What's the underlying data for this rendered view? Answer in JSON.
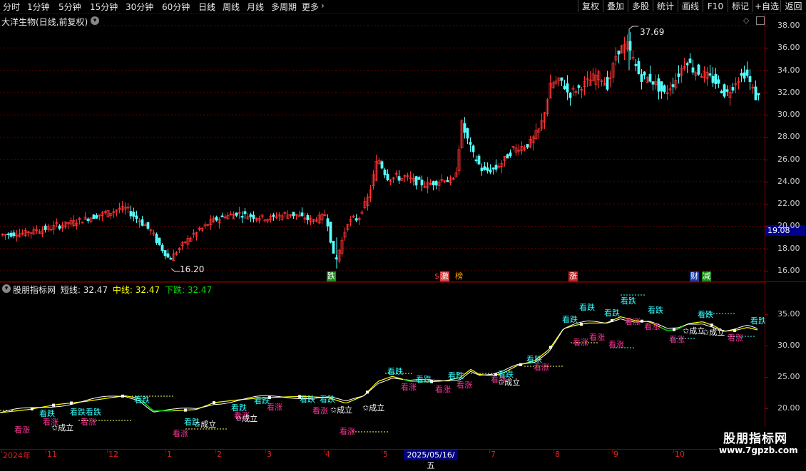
{
  "toolbar": {
    "periods": [
      "分时",
      "1分钟",
      "5分钟",
      "15分钟",
      "30分钟",
      "60分钟",
      "日线",
      "周线",
      "月线",
      "多周期",
      "更多"
    ],
    "active_period": "日线",
    "right_buttons": [
      "复权",
      "叠加",
      "多股",
      "统计",
      "画线",
      "F10",
      "标记",
      "+自选",
      "返回"
    ]
  },
  "main_chart": {
    "title": "大洋生物(日线,前复权)",
    "y_labels": [
      "38.00",
      "36.00",
      "34.00",
      "32.00",
      "30.00",
      "28.00",
      "26.00",
      "24.00",
      "22.00",
      "20.00",
      "18.00",
      "16.00"
    ],
    "high_label": "37.69",
    "low_label": "16.20",
    "current_price": "19.08",
    "event_tags": [
      {
        "text": "跌",
        "bg": "#1a8f1a",
        "fg": "#ffffff"
      },
      {
        "text": "$",
        "bg": "#000000",
        "fg": "#ff3030"
      },
      {
        "text": "激",
        "bg": "#d04040",
        "fg": "#ffffff"
      },
      {
        "text": "榜",
        "bg": "#000000",
        "fg": "#ffa500"
      },
      {
        "text": "涨",
        "bg": "#c02020",
        "fg": "#ffffff"
      },
      {
        "text": "财",
        "bg": "#1e3aa0",
        "fg": "#ffffff"
      },
      {
        "text": "减",
        "bg": "#1a8f1a",
        "fg": "#ffffff"
      }
    ]
  },
  "indicator": {
    "name": "股朋指标网",
    "short_label": "短线:",
    "short_value": "32.47",
    "mid_label": "中线:",
    "mid_value": "32.47",
    "down_label": "下跌:",
    "down_value": "32.47",
    "y_labels": [
      "35.00",
      "30.00",
      "25.00",
      "20.00"
    ],
    "signals": {
      "up_text": "看涨",
      "down_text": "看跌",
      "formed_text": "✩成立"
    }
  },
  "date_axis": {
    "labels": [
      "2024年",
      "11",
      "12",
      "1",
      "2",
      "3",
      "4",
      "5",
      "7",
      "8",
      "9",
      "10"
    ],
    "current": "2025/05/16/五"
  },
  "watermark": {
    "line1": "股朋指标网",
    "line2": "www.7gpzb.com"
  },
  "colors": {
    "up": "#ff3333",
    "down": "#54ffff",
    "grid": "#7a0000",
    "short": "#ffffff",
    "mid": "#ffff00",
    "down_line": "#00cc00",
    "signal_up": "#ff3399",
    "signal_down": "#33ffff"
  }
}
